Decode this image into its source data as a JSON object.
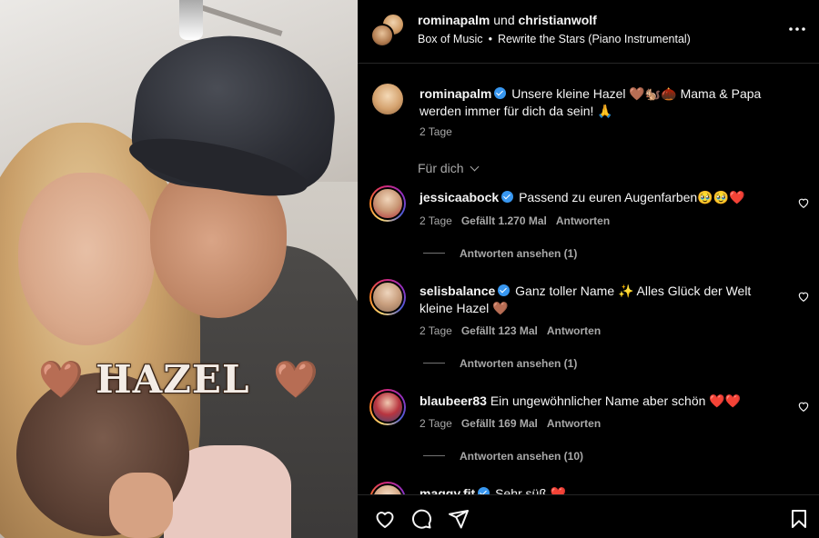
{
  "media": {
    "overlay_text": "HAZEL",
    "left_heart": "🤎",
    "right_heart": "🤎"
  },
  "header": {
    "user1": "rominapalm",
    "connector": "und",
    "user2": "christianwolf",
    "audio_artist": "Box of Music",
    "separator": "•",
    "audio_track": "Rewrite the Stars (Piano Instrumental)",
    "icons": [
      "more-icon"
    ]
  },
  "caption": {
    "username": "rominapalm",
    "text": "Unsere kleine Hazel 🤎🐿️🌰 Mama & Papa werden immer für dich da sein! 🙏",
    "time": "2 Tage"
  },
  "sort_label": "Für dich",
  "comments": [
    {
      "username": "jessicaabock",
      "verified": true,
      "text": "Passend zu euren Augenfarben🥹🥹❤️",
      "time": "2 Tage",
      "likes": "Gefällt 1.270 Mal",
      "reply": "Antworten",
      "view_replies": "Antworten ansehen (1)"
    },
    {
      "username": "selisbalance",
      "verified": true,
      "text": "Ganz toller Name ✨ Alles Glück der Welt kleine Hazel 🤎",
      "time": "2 Tage",
      "likes": "Gefällt 123 Mal",
      "reply": "Antworten",
      "view_replies": "Antworten ansehen (1)"
    },
    {
      "username": "blaubeer83",
      "verified": false,
      "text": "Ein ungewöhnlicher Name aber schön ❤️❤️",
      "time": "2 Tage",
      "likes": "Gefällt 169 Mal",
      "reply": "Antworten",
      "view_replies": "Antworten ansehen (10)"
    },
    {
      "username": "maggy.fit",
      "verified": true,
      "text": "Sehr süß ❤️"
    }
  ],
  "action_icons": [
    "like-icon",
    "comment-icon",
    "share-icon",
    "save-icon"
  ],
  "colors": {
    "background": "#000000",
    "text": "#f5f5f5",
    "muted": "#a8a8a8",
    "verified": "#3897f0",
    "divider": "#262626"
  }
}
